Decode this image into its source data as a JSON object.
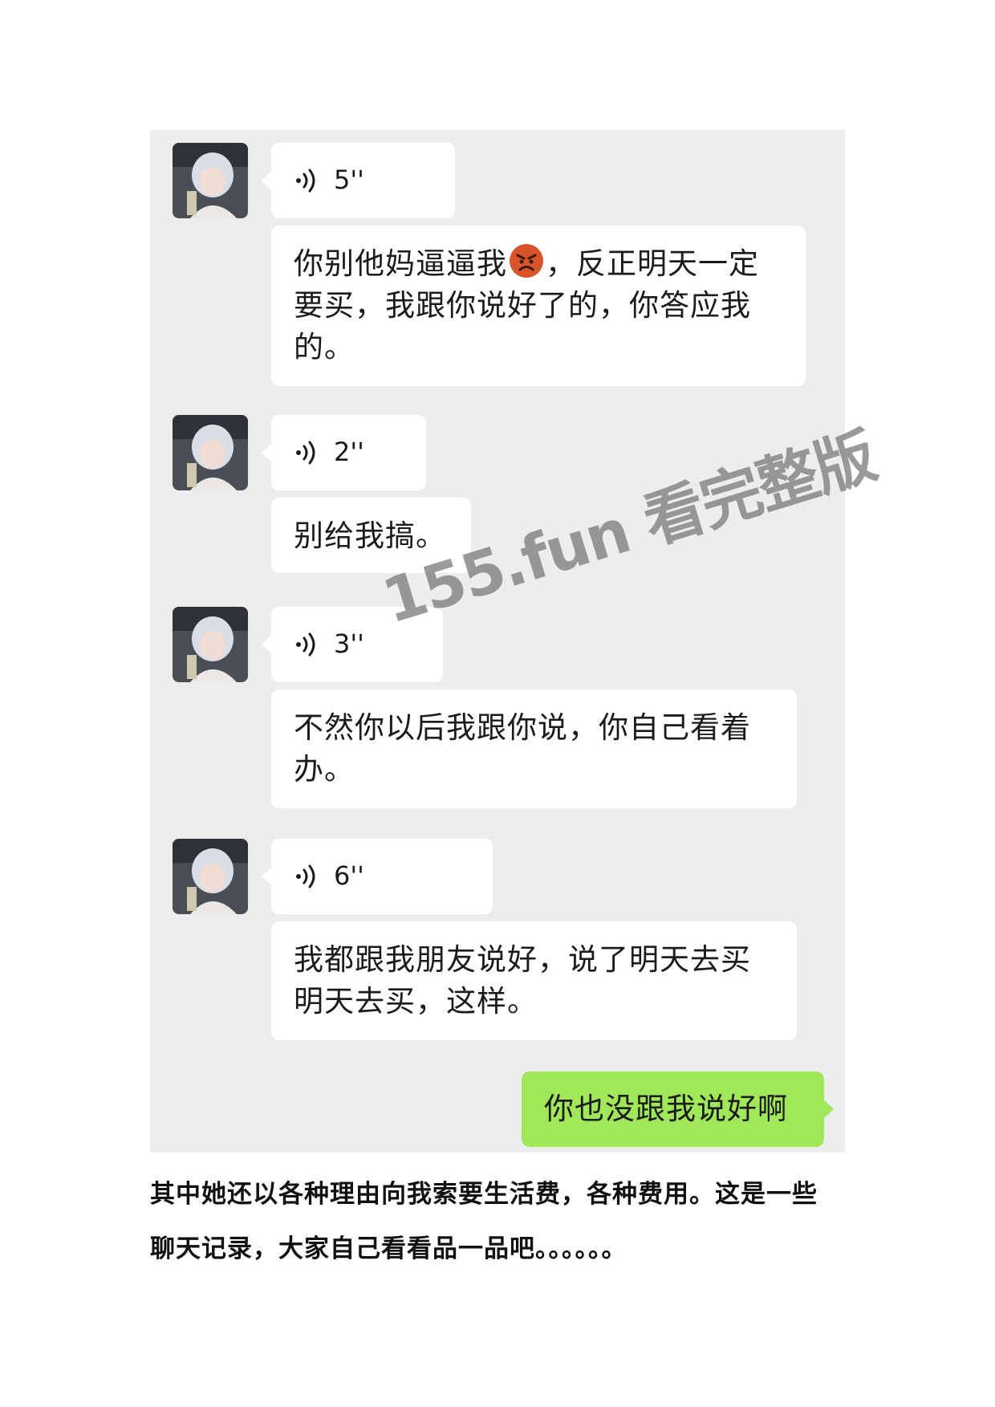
{
  "messages": {
    "m1": {
      "duration": "5''",
      "text": [
        "你别他妈逼逼我",
        "，反正明天一定",
        "要买，我跟你说好了的，你答应我",
        "的。"
      ]
    },
    "m2": {
      "duration": "2''",
      "text": "别给我搞。"
    },
    "m3": {
      "duration": "3''",
      "text": [
        "不然你以后我跟你说，你自己看着",
        "办。"
      ]
    },
    "m4": {
      "duration": "6''",
      "text": [
        "我都跟我朋友说好，说了明天去买",
        "明天去买，这样。"
      ]
    }
  },
  "sent_message": "你也没跟我说好啊",
  "watermark": "155.fun 看完整版",
  "caption": {
    "line1": "其中她还以各种理由向我索要生活费，各种费用。这是一些",
    "line2": "聊天记录，大家自己看看品一品吧。。。。。。"
  },
  "icons": {
    "voice": "voice-wave-icon",
    "emoji": "angry-face-emoji",
    "avatar": "avatar-photo"
  },
  "colors": {
    "chat_background": "#ededed",
    "received_bubble": "#ffffff",
    "sent_bubble": "#a0e75a",
    "emoji_face": "#d9532b"
  }
}
